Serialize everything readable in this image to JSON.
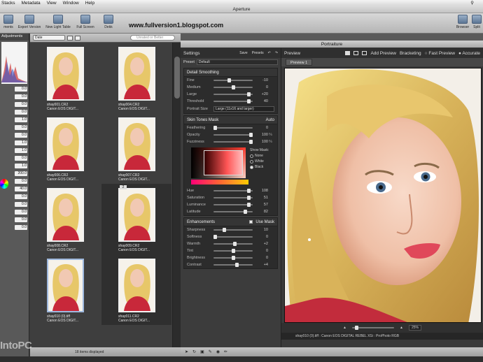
{
  "menubar": {
    "items": [
      "Stacks",
      "Metadata",
      "View",
      "Window",
      "Help"
    ]
  },
  "window": {
    "title": "Aperture"
  },
  "toolbar": {
    "items": [
      {
        "label": "ments"
      },
      {
        "label": "Export Version"
      },
      {
        "label": "New Light Table"
      },
      {
        "label": "Full Screen"
      },
      {
        "label": "Dekk"
      }
    ],
    "right_items": [
      {
        "label": "Browser"
      },
      {
        "label": "Split"
      }
    ]
  },
  "watermark_url": "www.fullversion1.blogspot.com",
  "left_panel": {
    "header": "Adjustments",
    "values": [
      "0.0",
      "0.0",
      "0.0",
      "0.0",
      "1.0",
      "0.0",
      "0.0",
      "1.0",
      "1.0",
      "0.0",
      "1.0",
      "200.0",
      "0.0",
      "40.0",
      "0.0",
      "0.0",
      "0.0",
      "0.0",
      "0.0"
    ]
  },
  "browser": {
    "sort": "Date",
    "search_placeholder": "Unrated or Better",
    "thumbnails": [
      {
        "name": "shay001.CR2",
        "camera": "Canon EOS DIGIT...",
        "dark": false
      },
      {
        "name": "shay004.CR2",
        "camera": "Canon EOS DIGIT...",
        "dark": false
      },
      {
        "name": "shay006.CR2",
        "camera": "Canon EOS DIGIT...",
        "dark": false
      },
      {
        "name": "shay007.CR2",
        "camera": "Canon EOS DIGIT...",
        "dark": false
      },
      {
        "name": "shay008.CR2",
        "camera": "Canon EOS DIGIT...",
        "dark": false
      },
      {
        "name": "shay009.CR2",
        "camera": "Canon EOS DIGIT...",
        "dark": true,
        "badge": "2"
      },
      {
        "name": "shay010 (0).tiff",
        "camera": "Canon EOS DIGIT...",
        "dark": false,
        "selected": true
      },
      {
        "name": "shay011.CR2",
        "camera": "Canon EOS DIGIT...",
        "dark": true
      }
    ],
    "footer": "18 items displayed"
  },
  "portraiture": {
    "title": "Portraiture",
    "settings": {
      "title": "Settings",
      "save": "Save",
      "presets": "Presets",
      "preset_label": "Preset",
      "preset_value": "Default",
      "detail_smoothing": {
        "title": "Detail Smoothing",
        "sliders": [
          {
            "label": "Fine",
            "value": "-10",
            "fraction": 0.4
          },
          {
            "label": "Medium",
            "value": "0",
            "fraction": 0.5
          },
          {
            "label": "Large",
            "value": "+20",
            "fraction": 0.95
          },
          {
            "label": "Threshold",
            "value": "40",
            "fraction": 0.95
          }
        ],
        "portrait_size_label": "Portrait Size",
        "portrait_size_value": "Large (11x16 and larger)"
      },
      "skin_tones_mask": {
        "title": "Skin Tones Mask",
        "mode": "Auto",
        "sliders": [
          {
            "label": "Feathering",
            "value": "0",
            "unit": "",
            "fraction": 0.0
          },
          {
            "label": "Opacity",
            "value": "100",
            "unit": "%",
            "fraction": 1.0
          },
          {
            "label": "Fuzziness",
            "value": "100",
            "unit": "%",
            "fraction": 1.0
          }
        ],
        "show_mask_title": "Show Mask:",
        "show_mask_options": [
          "None",
          "White",
          "Black"
        ],
        "color_sliders": [
          {
            "label": "Hue",
            "value": "108",
            "fraction": 0.95
          },
          {
            "label": "Saturation",
            "value": "51",
            "fraction": 0.95
          },
          {
            "label": "Luminance",
            "value": "57",
            "fraction": 0.95
          },
          {
            "label": "Latitude",
            "value": "82",
            "fraction": 0.85
          }
        ]
      },
      "enhancements": {
        "title": "Enhancements",
        "use_mask": "Use Mask",
        "sliders": [
          {
            "label": "Sharpness",
            "value": "10",
            "fraction": 0.25
          },
          {
            "label": "Softness",
            "value": "0",
            "fraction": 0.0
          },
          {
            "label": "Warmth",
            "value": "+2",
            "fraction": 0.55
          },
          {
            "label": "Tint",
            "value": "0",
            "fraction": 0.5
          },
          {
            "label": "Brightness",
            "value": "0",
            "fraction": 0.5
          },
          {
            "label": "Contrast",
            "value": "+4",
            "fraction": 0.6
          }
        ]
      }
    },
    "preview": {
      "title": "Preview",
      "add_preview": "Add Preview",
      "bracketing": "Bracketing",
      "fast_preview": "Fast Preview",
      "accurate": "Accurate",
      "tab": "Preview 1",
      "zoom": "25%",
      "status": "shay010 (0).tiff : Canon EOS DIGITAL REBEL XSi : ProPhoto RGB"
    }
  },
  "bottom_watermark": "IntoPC"
}
